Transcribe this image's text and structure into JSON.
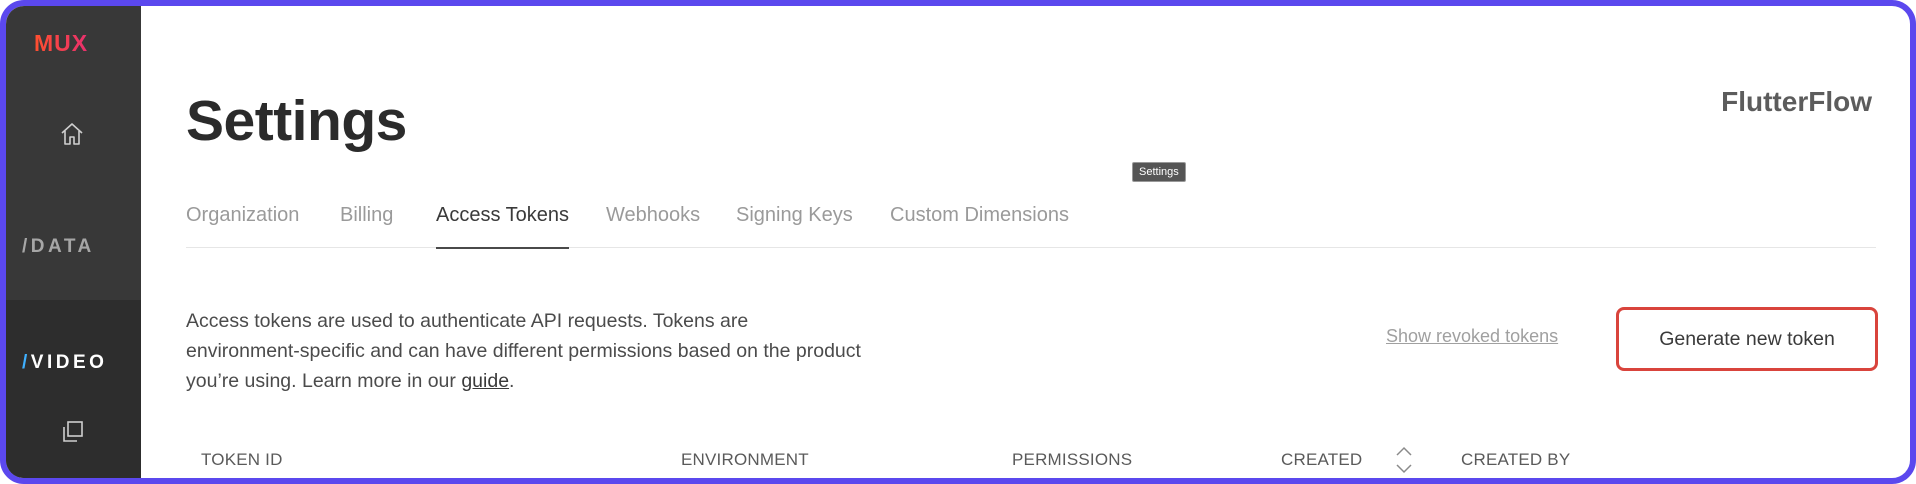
{
  "sidebar": {
    "logo": "MUX",
    "data_slash": "/",
    "data_label": "DATA",
    "video_slash": "/",
    "video_label": "VIDEO",
    "icons": [
      "home-icon",
      "copy-icon"
    ]
  },
  "header": {
    "title": "Settings",
    "org_name": "FlutterFlow",
    "tooltip": "Settings"
  },
  "tabs": [
    {
      "label": "Organization",
      "active": false
    },
    {
      "label": "Billing",
      "active": false
    },
    {
      "label": "Access Tokens",
      "active": true
    },
    {
      "label": "Webhooks",
      "active": false
    },
    {
      "label": "Signing Keys",
      "active": false
    },
    {
      "label": "Custom Dimensions",
      "active": false
    }
  ],
  "main": {
    "description_text": "Access tokens are used to authenticate API requests. Tokens are environment-specific and can have different permissions based on the product you’re using. Learn more in our ",
    "guide_link": "guide",
    "description_end": ".",
    "show_revoked": "Show revoked tokens",
    "generate_button": "Generate new token"
  },
  "table": {
    "columns": [
      "TOKEN ID",
      "ENVIRONMENT",
      "PERMISSIONS",
      "CREATED",
      "CREATED BY"
    ]
  },
  "colors": {
    "frame": "#5b48ee",
    "sidebar": "#383838",
    "button_border": "#d9443c",
    "video_slash": "#3fb0ff"
  }
}
